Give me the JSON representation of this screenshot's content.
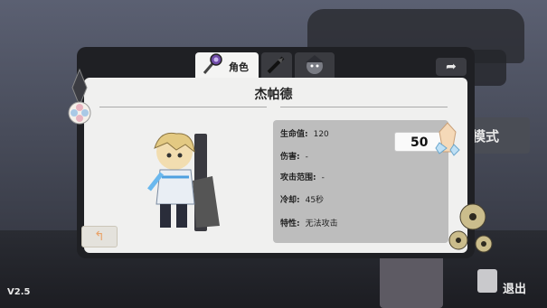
{
  "background": {
    "mode_text": "模式",
    "exit_label": "退出",
    "version": "V2.5"
  },
  "tabs": [
    {
      "label": "角色",
      "icon": "scepter-icon",
      "active": true
    },
    {
      "label": "",
      "icon": "weapon-icon",
      "active": false
    },
    {
      "label": "",
      "icon": "character-portrait-icon",
      "active": false
    }
  ],
  "share_icon": "share-icon",
  "character": {
    "name": "杰帕德",
    "price": "50",
    "currency_icon": "crystal-icon",
    "stats": [
      {
        "label": "生命值:",
        "value": "120"
      },
      {
        "label": "伤害:",
        "value": "-"
      },
      {
        "label": "攻击范围:",
        "value": "-"
      },
      {
        "label": "冷却:",
        "value": "45秒"
      },
      {
        "label": "特性:",
        "value": "无法攻击"
      }
    ]
  },
  "back_icon": "back-arrow-icon",
  "colors": {
    "panel_bg": "#f0f0ef",
    "stats_bg": "#bdbdbd",
    "frame": "#1f2024",
    "back_arrow": "#e9a46b"
  }
}
